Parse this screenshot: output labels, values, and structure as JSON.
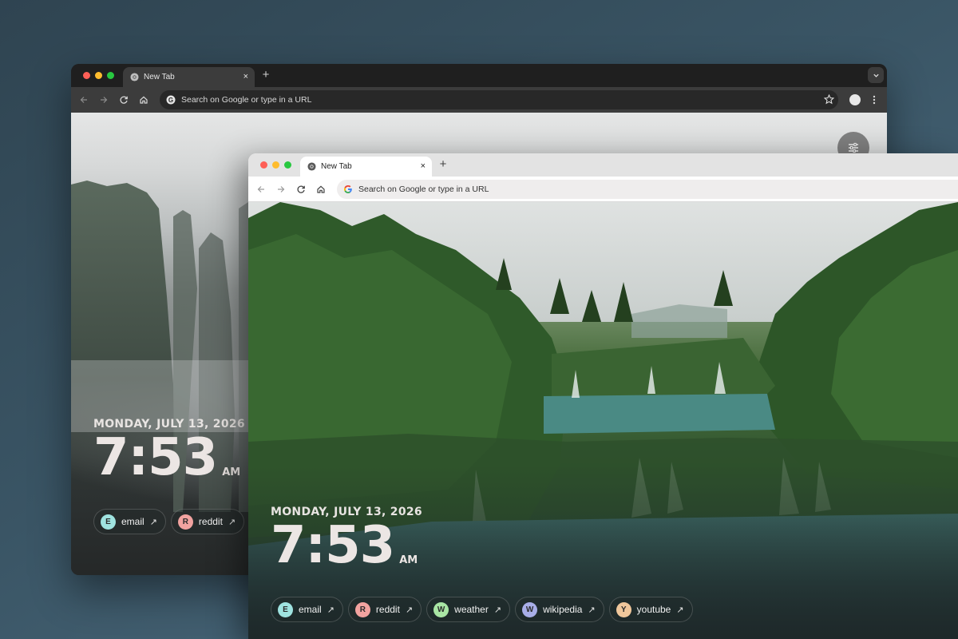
{
  "colors": {
    "email_badge": "#9fe3e0",
    "reddit_badge": "#f2a3a0",
    "weather_badge": "#a9e6a5",
    "wikipedia_badge": "#a8aee8",
    "youtube_badge": "#f0c79c"
  },
  "back_window": {
    "tab": {
      "title": "New Tab",
      "close": "×"
    },
    "newtab": "+",
    "omnibox": {
      "placeholder": "Search on Google or type in a URL"
    },
    "date": "MONDAY, JULY 13, 2026",
    "time": "7:53",
    "ampm": "AM",
    "links": [
      {
        "letter": "E",
        "label": "email",
        "arrow": "↗"
      },
      {
        "letter": "R",
        "label": "reddit",
        "arrow": "↗"
      }
    ]
  },
  "front_window": {
    "tab": {
      "title": "New Tab",
      "close": "×"
    },
    "newtab": "+",
    "omnibox": {
      "placeholder": "Search on Google or type in a URL"
    },
    "date": "MONDAY, JULY 13, 2026",
    "time": "7:53",
    "ampm": "AM",
    "links": [
      {
        "letter": "E",
        "label": "email",
        "arrow": "↗"
      },
      {
        "letter": "R",
        "label": "reddit",
        "arrow": "↗"
      },
      {
        "letter": "W",
        "label": "weather",
        "arrow": "↗"
      },
      {
        "letter": "W",
        "label": "wikipedia",
        "arrow": "↗"
      },
      {
        "letter": "Y",
        "label": "youtube",
        "arrow": "↗"
      }
    ]
  }
}
